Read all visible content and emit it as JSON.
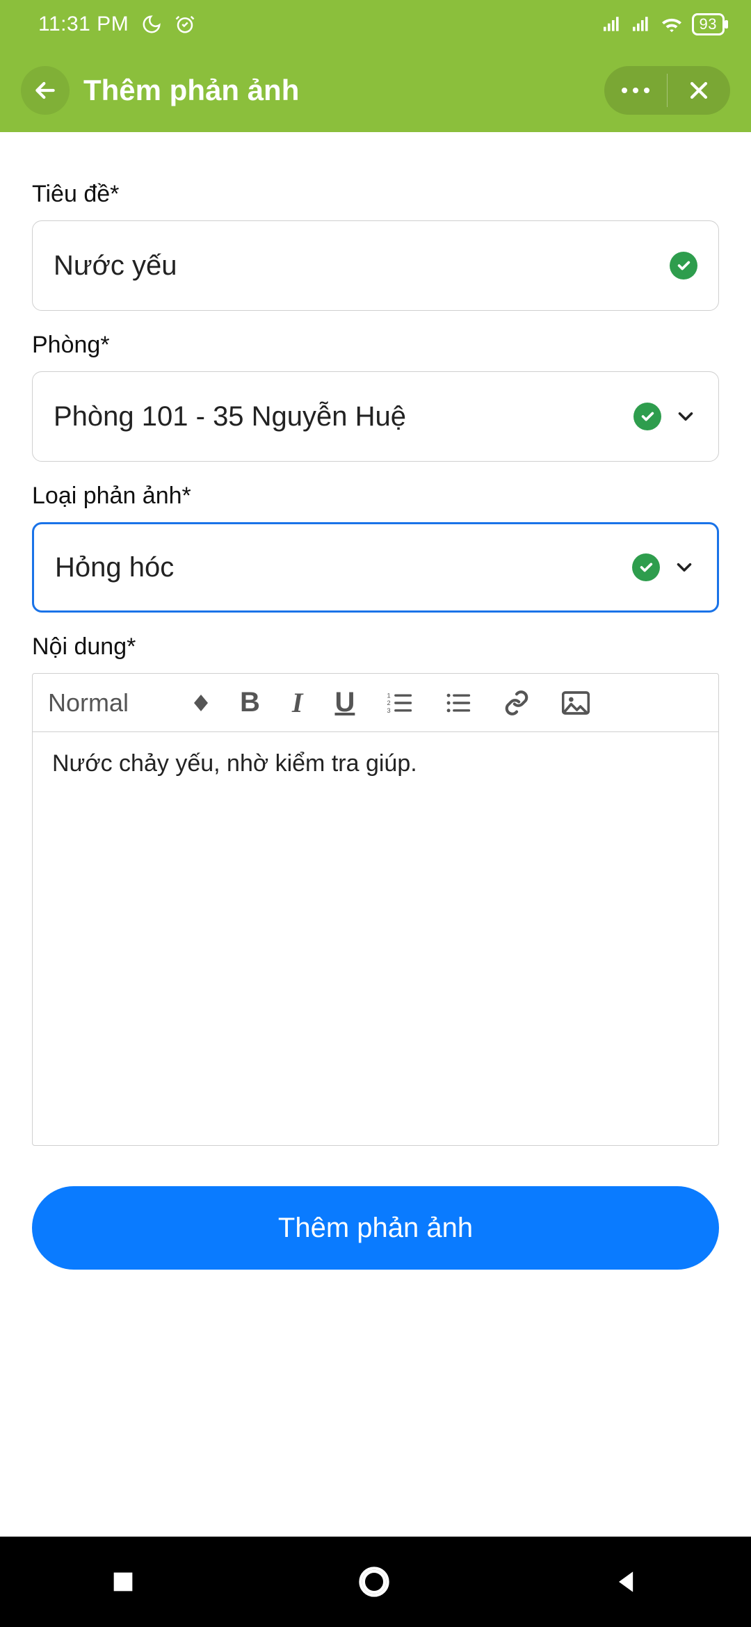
{
  "status": {
    "time": "11:31 PM",
    "battery": "93"
  },
  "appbar": {
    "title": "Thêm phản ảnh"
  },
  "form": {
    "title_label": "Tiêu đề*",
    "title_value": "Nước yếu",
    "room_label": "Phòng*",
    "room_value": "Phòng 101 - 35 Nguyễn Huệ",
    "type_label": "Loại phản ảnh*",
    "type_value": "Hỏng hóc",
    "content_label": "Nội dung*",
    "editor": {
      "heading_option": "Normal",
      "body": "Nước chảy yếu, nhờ kiểm tra giúp."
    }
  },
  "submit_label": "Thêm phản ảnh"
}
